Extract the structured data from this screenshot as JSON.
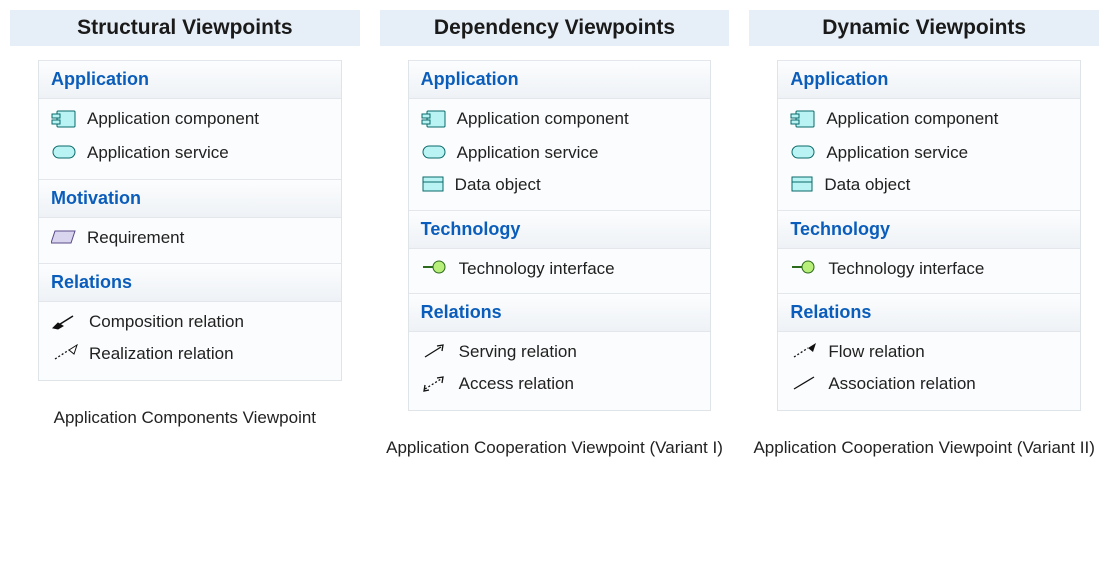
{
  "columns": [
    {
      "header": "Structural Viewpoints",
      "caption": "Application Components Viewpoint",
      "sections": [
        {
          "title": "Application",
          "items": [
            {
              "icon": "app-component",
              "label": "Application component"
            },
            {
              "icon": "app-service",
              "label": "Application service"
            }
          ]
        },
        {
          "title": "Motivation",
          "items": [
            {
              "icon": "requirement",
              "label": "Requirement"
            }
          ]
        },
        {
          "title": "Relations",
          "items": [
            {
              "icon": "composition",
              "label": "Composition relation"
            },
            {
              "icon": "realization",
              "label": "Realization relation"
            }
          ]
        }
      ]
    },
    {
      "header": "Dependency Viewpoints",
      "caption": "Application Cooperation Viewpoint (Variant I)",
      "sections": [
        {
          "title": "Application",
          "items": [
            {
              "icon": "app-component",
              "label": "Application component"
            },
            {
              "icon": "app-service",
              "label": "Application service"
            },
            {
              "icon": "data-object",
              "label": "Data object"
            }
          ]
        },
        {
          "title": "Technology",
          "items": [
            {
              "icon": "tech-interface",
              "label": "Technology interface"
            }
          ]
        },
        {
          "title": "Relations",
          "items": [
            {
              "icon": "serving",
              "label": "Serving relation"
            },
            {
              "icon": "access",
              "label": "Access relation"
            }
          ]
        }
      ]
    },
    {
      "header": "Dynamic Viewpoints",
      "caption": "Application Cooperation Viewpoint (Variant II)",
      "sections": [
        {
          "title": "Application",
          "items": [
            {
              "icon": "app-component",
              "label": "Application component"
            },
            {
              "icon": "app-service",
              "label": "Application service"
            },
            {
              "icon": "data-object",
              "label": "Data object"
            }
          ]
        },
        {
          "title": "Technology",
          "items": [
            {
              "icon": "tech-interface",
              "label": "Technology interface"
            }
          ]
        },
        {
          "title": "Relations",
          "items": [
            {
              "icon": "flow",
              "label": "Flow relation"
            },
            {
              "icon": "association",
              "label": "Association relation"
            }
          ]
        }
      ]
    }
  ]
}
